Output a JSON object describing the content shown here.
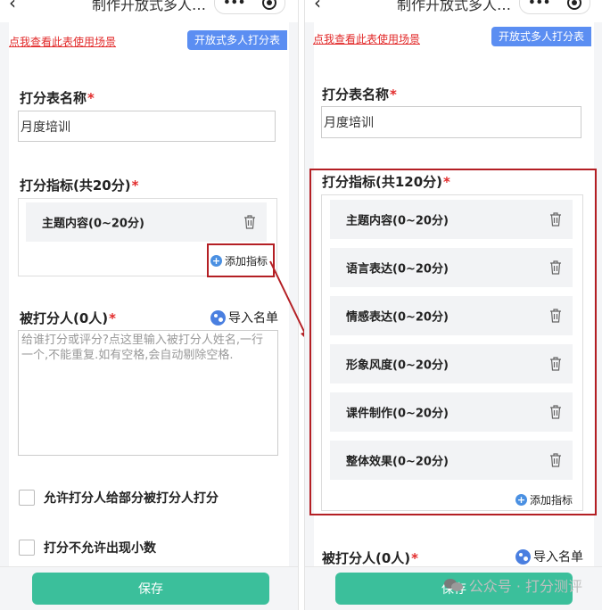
{
  "left": {
    "title": "制作开放式多人…",
    "scene_link": "点我查看此表使用场景",
    "type_button": "开放式多人打分表",
    "name_label": "打分表名称",
    "name_value": "月度培训",
    "indicator_label": "打分指标(共20分)",
    "indicators": [
      {
        "label": "主题内容(0~20分)"
      }
    ],
    "add_indicator": "添加指标",
    "ratee_label": "被打分人(0人)",
    "import_list": "导入名单",
    "ratee_placeholder": "给谁打分或评分?点这里输入被打分人姓名,一行一个,不能重复.如有空格,会自动剔除空格.",
    "option1": "允许打分人给部分被打分人打分",
    "option2": "打分不允许出现小数",
    "save": "保存"
  },
  "right": {
    "title": "制作开放式多人…",
    "scene_link": "点我查看此表使用场景",
    "type_button": "开放式多人打分表",
    "name_label": "打分表名称",
    "name_value": "月度培训",
    "indicator_label": "打分指标(共120分)",
    "indicators": [
      {
        "label": "主题内容(0~20分)"
      },
      {
        "label": "语言表达(0~20分)"
      },
      {
        "label": "情感表达(0~20分)"
      },
      {
        "label": "形象风度(0~20分)"
      },
      {
        "label": "课件制作(0~20分)"
      },
      {
        "label": "整体效果(0~20分)"
      }
    ],
    "add_indicator": "添加指标",
    "ratee_label": "被打分人(0人)",
    "import_list": "导入名单",
    "save": "保存"
  },
  "watermark": "公众号 · 打分测评",
  "colors": {
    "accent_red": "#b41f24",
    "save_green": "#3bbf9b",
    "type_blue": "#5b8ef2",
    "required_red": "#e22b2b"
  }
}
